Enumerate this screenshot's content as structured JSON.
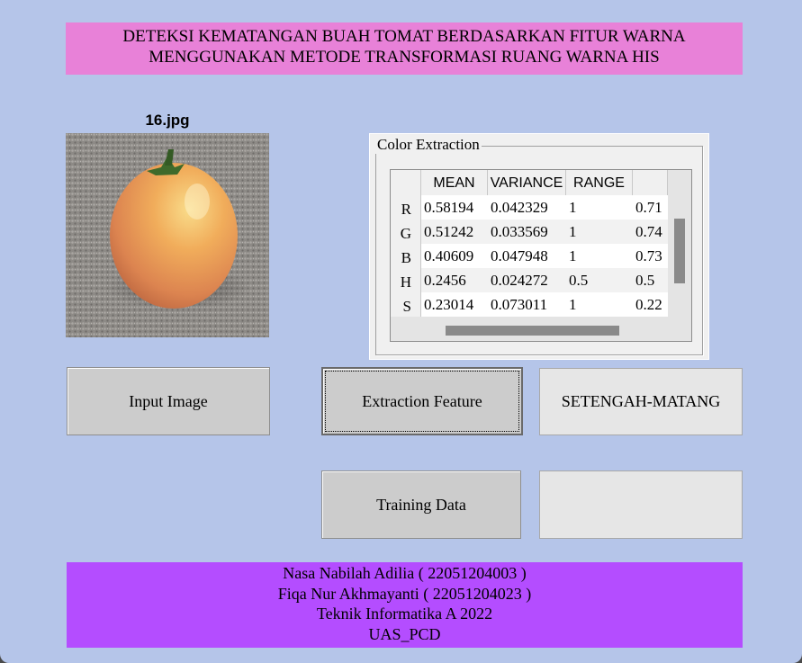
{
  "title": {
    "line1": "DETEKSI KEMATANGAN BUAH TOMAT BERDASARKAN FITUR WARNA",
    "line2": "MENGGUNAKAN METODE TRANSFORMASI RUANG WARNA HIS"
  },
  "image": {
    "label": "16.jpg"
  },
  "panel": {
    "title": "Color Extraction",
    "columns": [
      "MEAN",
      "VARIANCE",
      "RANGE",
      ""
    ],
    "rows": [
      {
        "label": "R",
        "cells": [
          "0.58194",
          "0.042329",
          "1",
          "0.71"
        ]
      },
      {
        "label": "G",
        "cells": [
          "0.51242",
          "0.033569",
          "1",
          "0.74"
        ]
      },
      {
        "label": "B",
        "cells": [
          "0.40609",
          "0.047948",
          "1",
          "0.73"
        ]
      },
      {
        "label": "H",
        "cells": [
          "0.2456",
          "0.024272",
          "0.5",
          "0.5"
        ]
      },
      {
        "label": "S",
        "cells": [
          "0.23014",
          "0.073011",
          "1",
          "0.22"
        ]
      }
    ]
  },
  "buttons": {
    "input_image": "Input Image",
    "extraction": "Extraction Feature",
    "training": "Training Data"
  },
  "results": {
    "result1": "SETENGAH-MATANG",
    "result2": ""
  },
  "footer": {
    "line1": "Nasa Nabilah Adilia ( 22051204003 )",
    "line2": "Fiqa Nur Akhmayanti ( 22051204023 )",
    "line3": "Teknik Informatika A 2022",
    "line4": "UAS_PCD"
  },
  "colors": {
    "background": "#b5c5e9",
    "title_banner": "#e881d8",
    "footer": "#b44dff",
    "button": "#cccccc"
  }
}
